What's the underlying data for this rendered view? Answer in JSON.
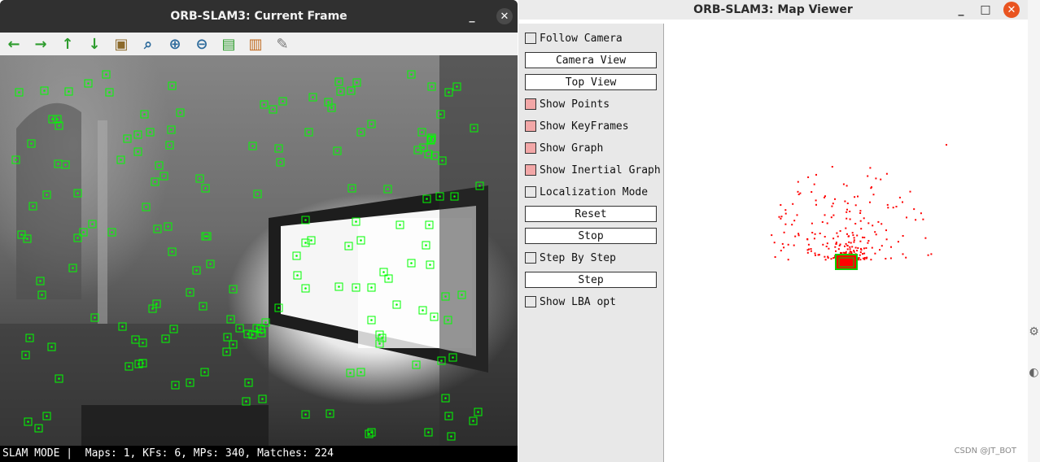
{
  "left_window": {
    "title": "ORB-SLAM3: Current Frame",
    "minimize": "_",
    "close": "✕",
    "toolbar": [
      {
        "name": "back-arrow-icon",
        "glyph": "←",
        "color": "#2e9c2e"
      },
      {
        "name": "forward-arrow-icon",
        "glyph": "→",
        "color": "#2e9c2e"
      },
      {
        "name": "up-arrow-icon",
        "glyph": "↑",
        "color": "#2e9c2e"
      },
      {
        "name": "down-arrow-icon",
        "glyph": "↓",
        "color": "#2e9c2e"
      },
      {
        "name": "image-icon",
        "glyph": "▣",
        "color": "#8c6a2b"
      },
      {
        "name": "zoom-fit-icon",
        "glyph": "⌕",
        "color": "#2e6b9c"
      },
      {
        "name": "zoom-in-icon",
        "glyph": "⊕",
        "color": "#2e6b9c"
      },
      {
        "name": "zoom-out-icon",
        "glyph": "⊖",
        "color": "#2e6b9c"
      },
      {
        "name": "save-icon",
        "glyph": "▤",
        "color": "#2e9c2e"
      },
      {
        "name": "clipboard-icon",
        "glyph": "▥",
        "color": "#c06a20"
      },
      {
        "name": "brush-icon",
        "glyph": "✎",
        "color": "#777777"
      }
    ],
    "status_text": "SLAM MODE |  Maps: 1, KFs: 6, MPs: 340, Matches: 224",
    "feature_color": "#00ff00"
  },
  "right_window": {
    "title": "ORB-SLAM3: Map Viewer",
    "minimize": "_",
    "maximize": "□",
    "close": "✕",
    "panel": {
      "follow_camera": "Follow Camera",
      "camera_view": "Camera View",
      "top_view": "Top View",
      "show_points": "Show Points",
      "show_keyframes": "Show KeyFrames",
      "show_graph": "Show Graph",
      "show_inertial_graph": "Show Inertial Graph",
      "localization_mode": "Localization Mode",
      "reset": "Reset",
      "stop": "Stop",
      "step_by_step": "Step By Step",
      "step": "Step",
      "show_lba_opt": "Show LBA opt"
    },
    "map_point_color": "#ff0000",
    "keyframe_color": "#00d000",
    "watermark": "CSDN @JT_BOT"
  }
}
